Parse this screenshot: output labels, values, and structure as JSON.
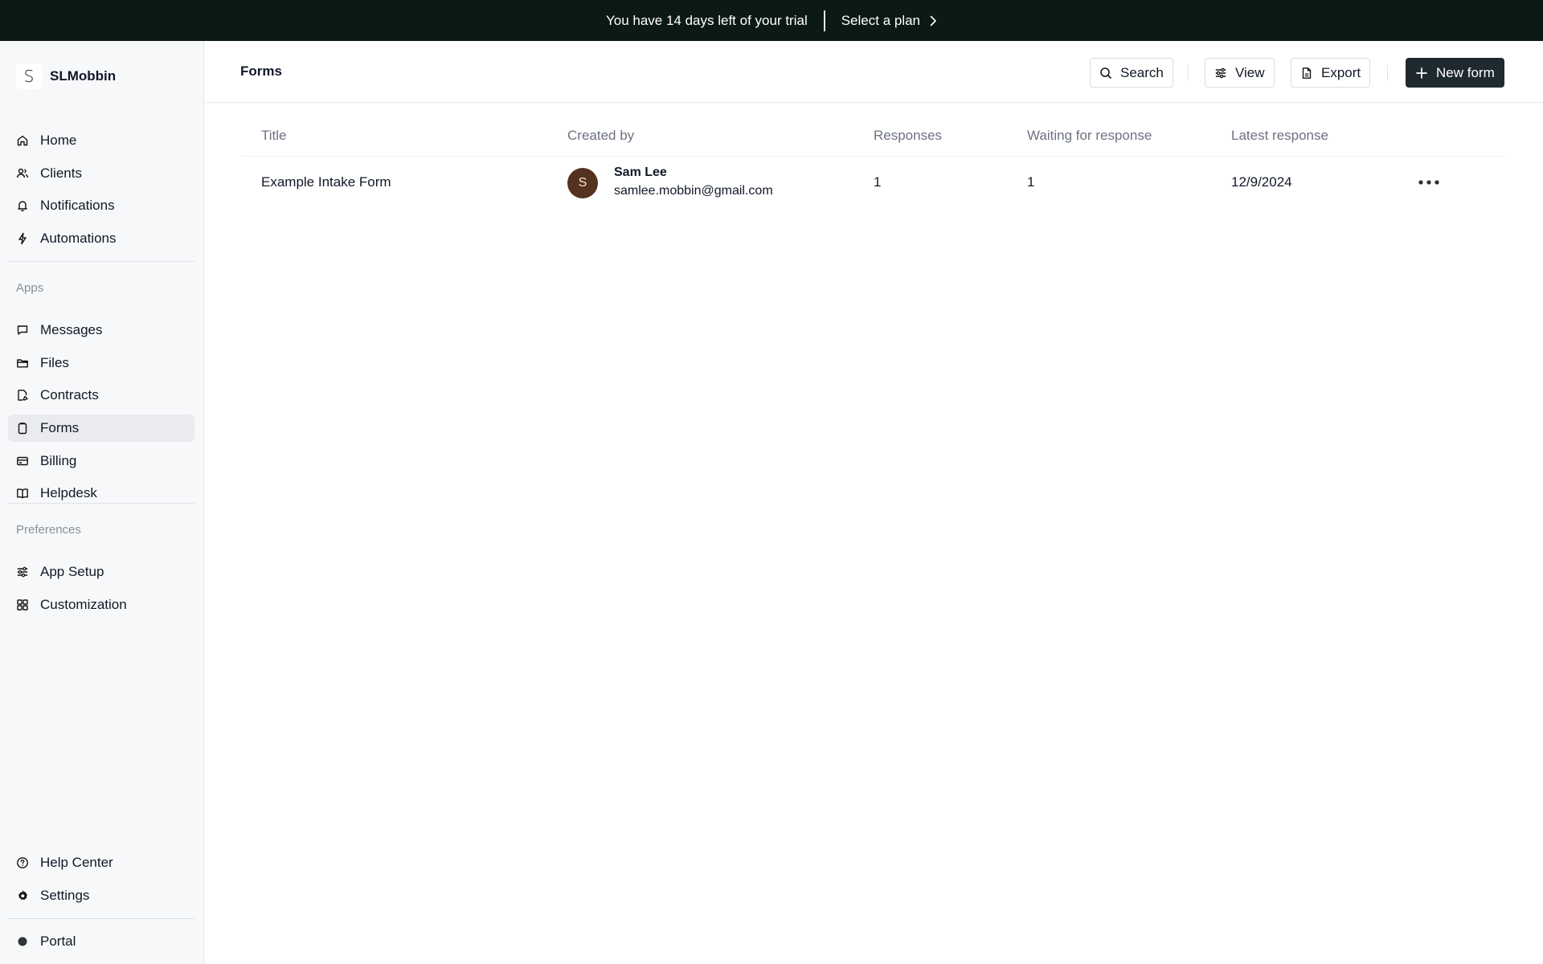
{
  "banner": {
    "trial_text": "You have 14 days left of your trial",
    "plan_link": "Select a plan"
  },
  "workspace": {
    "logo_letter": "S",
    "name": "SLMobbin"
  },
  "sidebar": {
    "main_items": [
      {
        "label": "Home",
        "icon": "home-icon"
      },
      {
        "label": "Clients",
        "icon": "users-icon"
      },
      {
        "label": "Notifications",
        "icon": "bell-icon"
      },
      {
        "label": "Automations",
        "icon": "bolt-icon"
      }
    ],
    "apps_label": "Apps",
    "app_items": [
      {
        "label": "Messages",
        "icon": "message-icon"
      },
      {
        "label": "Files",
        "icon": "folder-icon"
      },
      {
        "label": "Contracts",
        "icon": "contract-icon"
      },
      {
        "label": "Forms",
        "icon": "clipboard-icon",
        "active": true
      },
      {
        "label": "Billing",
        "icon": "credit-card-icon"
      },
      {
        "label": "Helpdesk",
        "icon": "book-icon"
      }
    ],
    "preferences_label": "Preferences",
    "pref_items": [
      {
        "label": "App Setup",
        "icon": "sliders-icon"
      },
      {
        "label": "Customization",
        "icon": "grid-icon"
      }
    ],
    "bottom_items": [
      {
        "label": "Help Center",
        "icon": "help-circle-icon"
      },
      {
        "label": "Settings",
        "icon": "gear-icon"
      }
    ],
    "portal_item": {
      "label": "Portal",
      "icon": "dot-icon"
    }
  },
  "header": {
    "title": "Forms",
    "search_label": "Search",
    "view_label": "View",
    "export_label": "Export",
    "new_form_label": "New form"
  },
  "table": {
    "columns": [
      "Title",
      "Created by",
      "Responses",
      "Waiting for response",
      "Latest response"
    ],
    "rows": [
      {
        "title": "Example Intake Form",
        "creator_initial": "S",
        "creator_name": "Sam Lee",
        "creator_email": "samlee.mobbin@gmail.com",
        "responses": "1",
        "waiting": "1",
        "latest": "12/9/2024"
      }
    ]
  },
  "colors": {
    "banner_bg": "#0c1a17",
    "primary_button": "#1f2a30",
    "sidebar_bg": "#f7f8f9",
    "avatar_bg": "#55321f"
  }
}
